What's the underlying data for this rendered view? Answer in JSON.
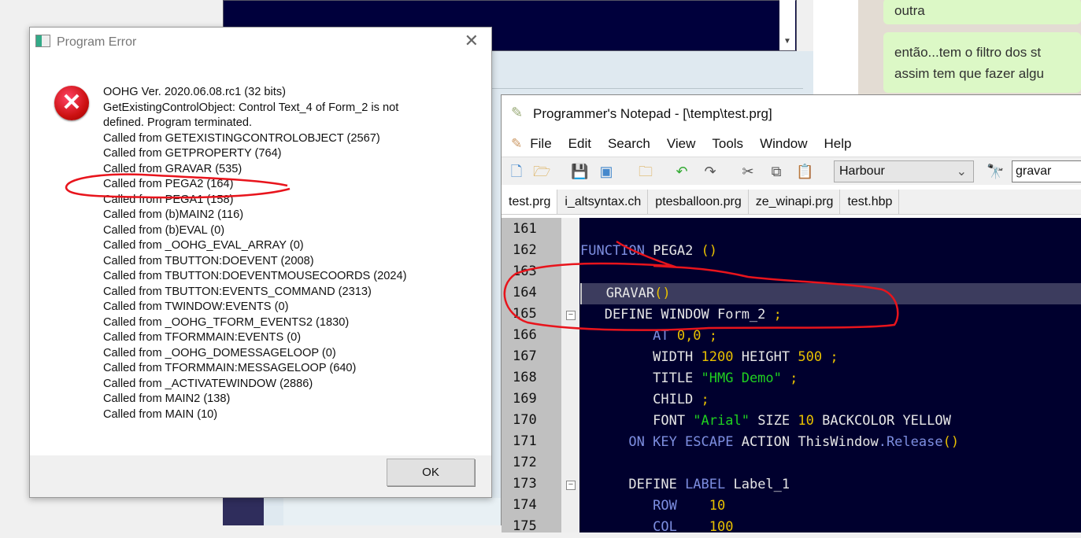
{
  "background": {
    "chat": [
      "outra",
      "então...tem o filtro dos st",
      "assim tem que fazer algu"
    ],
    "scroll_arrow": "▼"
  },
  "dialog": {
    "title": "Program Error",
    "icon": "error-icon",
    "messages": [
      "OOHG Ver. 2020.06.08.rc1 (32 bits)",
      "GetExistingControlObject: Control Text_4 of Form_2 is not",
      "defined. Program terminated.",
      "Called from GETEXISTINGCONTROLOBJECT (2567)",
      "Called from GETPROPERTY (764)",
      "Called from GRAVAR (535)",
      "Called from PEGA2 (164)",
      "Called from PEGA1 (158)",
      "Called from (b)MAIN2 (116)",
      "Called from (b)EVAL (0)",
      "Called from _OOHG_EVAL_ARRAY (0)",
      "Called from TBUTTON:DOEVENT (2008)",
      "Called from TBUTTON:DOEVENTMOUSECOORDS (2024)",
      "Called from TBUTTON:EVENTS_COMMAND (2313)",
      "Called from TWINDOW:EVENTS (0)",
      "Called from _OOHG_TFORM_EVENTS2 (1830)",
      "Called from TFORMMAIN:EVENTS (0)",
      "Called from _OOHG_DOMESSAGELOOP (0)",
      "Called from TFORMMAIN:MESSAGELOOP (640)",
      "Called from _ACTIVATEWINDOW (2886)",
      "Called from MAIN2 (138)",
      "Called from MAIN (10)"
    ],
    "ok_label": "OK"
  },
  "notepad": {
    "title": "Programmer's Notepad - [\\temp\\test.prg]",
    "menu": [
      "File",
      "Edit",
      "Search",
      "View",
      "Tools",
      "Window",
      "Help"
    ],
    "language": "Harbour",
    "find_value": "gravar",
    "tabs": [
      "test.prg",
      "i_altsyntax.ch",
      "ptesballoon.prg",
      "ze_winapi.prg",
      "test.hbp"
    ],
    "active_tab": 0,
    "current_line": 164,
    "lines": [
      {
        "n": "161",
        "t": []
      },
      {
        "n": "162",
        "t": [
          [
            "FUNCTION ",
            "kw"
          ],
          [
            "PEGA2 ",
            "id"
          ],
          [
            "()",
            "num"
          ]
        ]
      },
      {
        "n": "163",
        "t": []
      },
      {
        "n": "164",
        "t": [
          [
            "   GRAVAR",
            "id"
          ],
          [
            "()",
            "num"
          ]
        ]
      },
      {
        "n": "165",
        "t": [
          [
            "   DEFINE WINDOW Form_2 ",
            "id"
          ],
          [
            ";",
            "num"
          ]
        ],
        "fold": true
      },
      {
        "n": "166",
        "t": [
          [
            "         AT ",
            "kw"
          ],
          [
            "0,0 ;",
            "num"
          ]
        ]
      },
      {
        "n": "167",
        "t": [
          [
            "         WIDTH ",
            "id"
          ],
          [
            "1200 ",
            "num"
          ],
          [
            "HEIGHT ",
            "id"
          ],
          [
            "500 ;",
            "num"
          ]
        ]
      },
      {
        "n": "168",
        "t": [
          [
            "         TITLE ",
            "id"
          ],
          [
            "\"HMG Demo\" ",
            "str"
          ],
          [
            ";",
            "num"
          ]
        ]
      },
      {
        "n": "169",
        "t": [
          [
            "         CHILD ",
            "id"
          ],
          [
            ";",
            "num"
          ]
        ]
      },
      {
        "n": "170",
        "t": [
          [
            "         FONT ",
            "id"
          ],
          [
            "\"Arial\" ",
            "str"
          ],
          [
            "SIZE ",
            "id"
          ],
          [
            "10 ",
            "num"
          ],
          [
            "BACKCOLOR YELLOW",
            "id"
          ]
        ]
      },
      {
        "n": "171",
        "t": [
          [
            "      ON KEY ESCAPE ",
            "kw"
          ],
          [
            "ACTION ThisWindow",
            "id"
          ],
          [
            ".Release",
            "kw"
          ],
          [
            "()",
            "num"
          ]
        ]
      },
      {
        "n": "172",
        "t": []
      },
      {
        "n": "173",
        "t": [
          [
            "      DEFINE ",
            "id"
          ],
          [
            "LABEL ",
            "kw"
          ],
          [
            "Label_1",
            "id"
          ]
        ],
        "fold": true
      },
      {
        "n": "174",
        "t": [
          [
            "         ROW    ",
            "kw"
          ],
          [
            "10",
            "num"
          ]
        ]
      },
      {
        "n": "175",
        "t": [
          [
            "         COL    ",
            "kw"
          ],
          [
            "100",
            "num"
          ]
        ]
      }
    ]
  }
}
